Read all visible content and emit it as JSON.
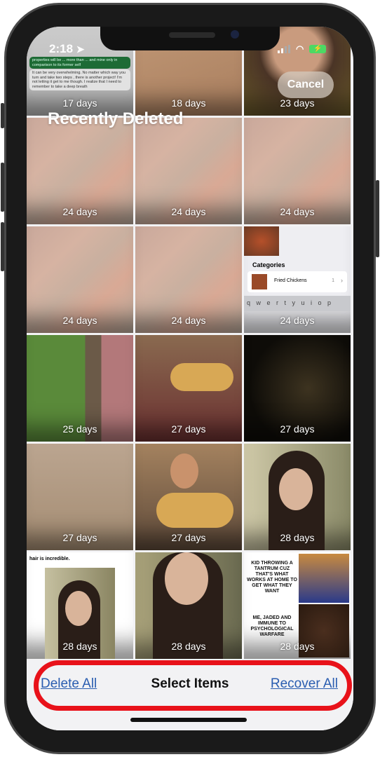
{
  "status_bar": {
    "time": "2:18",
    "location_icon": "location-arrow-icon",
    "signal_icon": "cellular-signal-icon",
    "wifi_icon": "wifi-icon",
    "battery_icon": "battery-charging-icon",
    "battery_color": "#4cd964"
  },
  "header": {
    "title": "Recently Deleted",
    "cancel_label": "Cancel"
  },
  "photos": [
    {
      "days": "17 days",
      "kind": "chat-screenshot",
      "text": "It can be very overwhelming. No matter which way you turn and take two steps , there is another project! I'm not letting it get to me though. I realize that I need to remember to take a deep breath",
      "bubble_text": "properties will be ... more than ... and mine only in comparison to its former self"
    },
    {
      "days": "18 days",
      "kind": "skin"
    },
    {
      "days": "23 days",
      "kind": "person"
    },
    {
      "days": "24 days",
      "kind": "blur"
    },
    {
      "days": "24 days",
      "kind": "blur"
    },
    {
      "days": "24 days",
      "kind": "blur"
    },
    {
      "days": "24 days",
      "kind": "blur"
    },
    {
      "days": "24 days",
      "kind": "blur"
    },
    {
      "days": "24 days",
      "kind": "categories",
      "categories_heading": "Categories",
      "category_name": "Fried Chickens",
      "category_count": "1",
      "keyboard": "q w e r t y u i o p"
    },
    {
      "days": "25 days",
      "kind": "door"
    },
    {
      "days": "27 days",
      "kind": "guitar"
    },
    {
      "days": "27 days",
      "kind": "dark"
    },
    {
      "days": "27 days",
      "kind": "carpet"
    },
    {
      "days": "27 days",
      "kind": "guitar"
    },
    {
      "days": "28 days",
      "kind": "portrait"
    },
    {
      "days": "28 days",
      "kind": "portrait-caption",
      "caption": "hair is incredible."
    },
    {
      "days": "28 days",
      "kind": "portrait"
    },
    {
      "days": "28 days",
      "kind": "meme",
      "meme_top": "KID THROWING A TANTRUM CUZ THAT'S WHAT WORKS AT HOME TO GET WHAT THEY WANT",
      "meme_bottom": "ME, JADED AND IMMUNE TO PSYCHOLOGICAL WARFARE"
    }
  ],
  "toolbar": {
    "delete_all": "Delete All",
    "select_items": "Select Items",
    "recover_all": "Recover All",
    "link_color": "#2a5db0",
    "highlight_color": "#e8121a"
  }
}
